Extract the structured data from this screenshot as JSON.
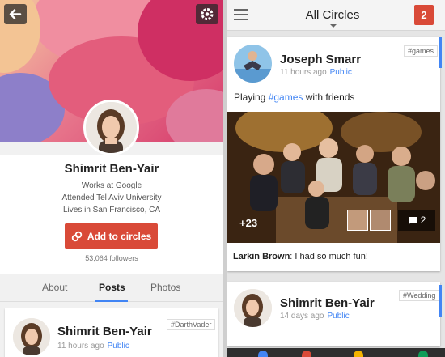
{
  "profile": {
    "name": "Shimrit Ben-Yair",
    "details": [
      "Works at Google",
      "Attended Tel Aviv University",
      "Lives in San Francisco, CA"
    ],
    "add_button": "Add to circles",
    "followers": "53,064 followers",
    "tabs": [
      {
        "label": "About"
      },
      {
        "label": "Posts"
      },
      {
        "label": "Photos"
      }
    ],
    "active_tab": "Posts",
    "post": {
      "author": "Shimrit Ben-Yair",
      "time": "11 hours ago",
      "visibility": "Public",
      "hashtag": "#DarthVader"
    }
  },
  "stream": {
    "title": "All Circles",
    "notification_count": "2",
    "posts": [
      {
        "author": "Joseph Smarr",
        "time": "11 hours ago",
        "visibility": "Public",
        "hashtag": "#games",
        "text_before": "Playing ",
        "text_tag": "#games",
        "text_after": " with friends",
        "photo_plus": "+23",
        "comments_count": "2",
        "comment_author": "Larkin Brown",
        "comment_text": ": I had so much fun!"
      },
      {
        "author": "Shimrit Ben-Yair",
        "time": "14 days ago",
        "visibility": "Public",
        "hashtag": "#Wedding"
      }
    ]
  },
  "colors": {
    "accent_red": "#d94a38",
    "link_blue": "#4285f4"
  },
  "icons": [
    "back-arrow-icon",
    "gear-icon",
    "link-icon",
    "menu-icon",
    "caret-down-icon",
    "comment-icon"
  ]
}
